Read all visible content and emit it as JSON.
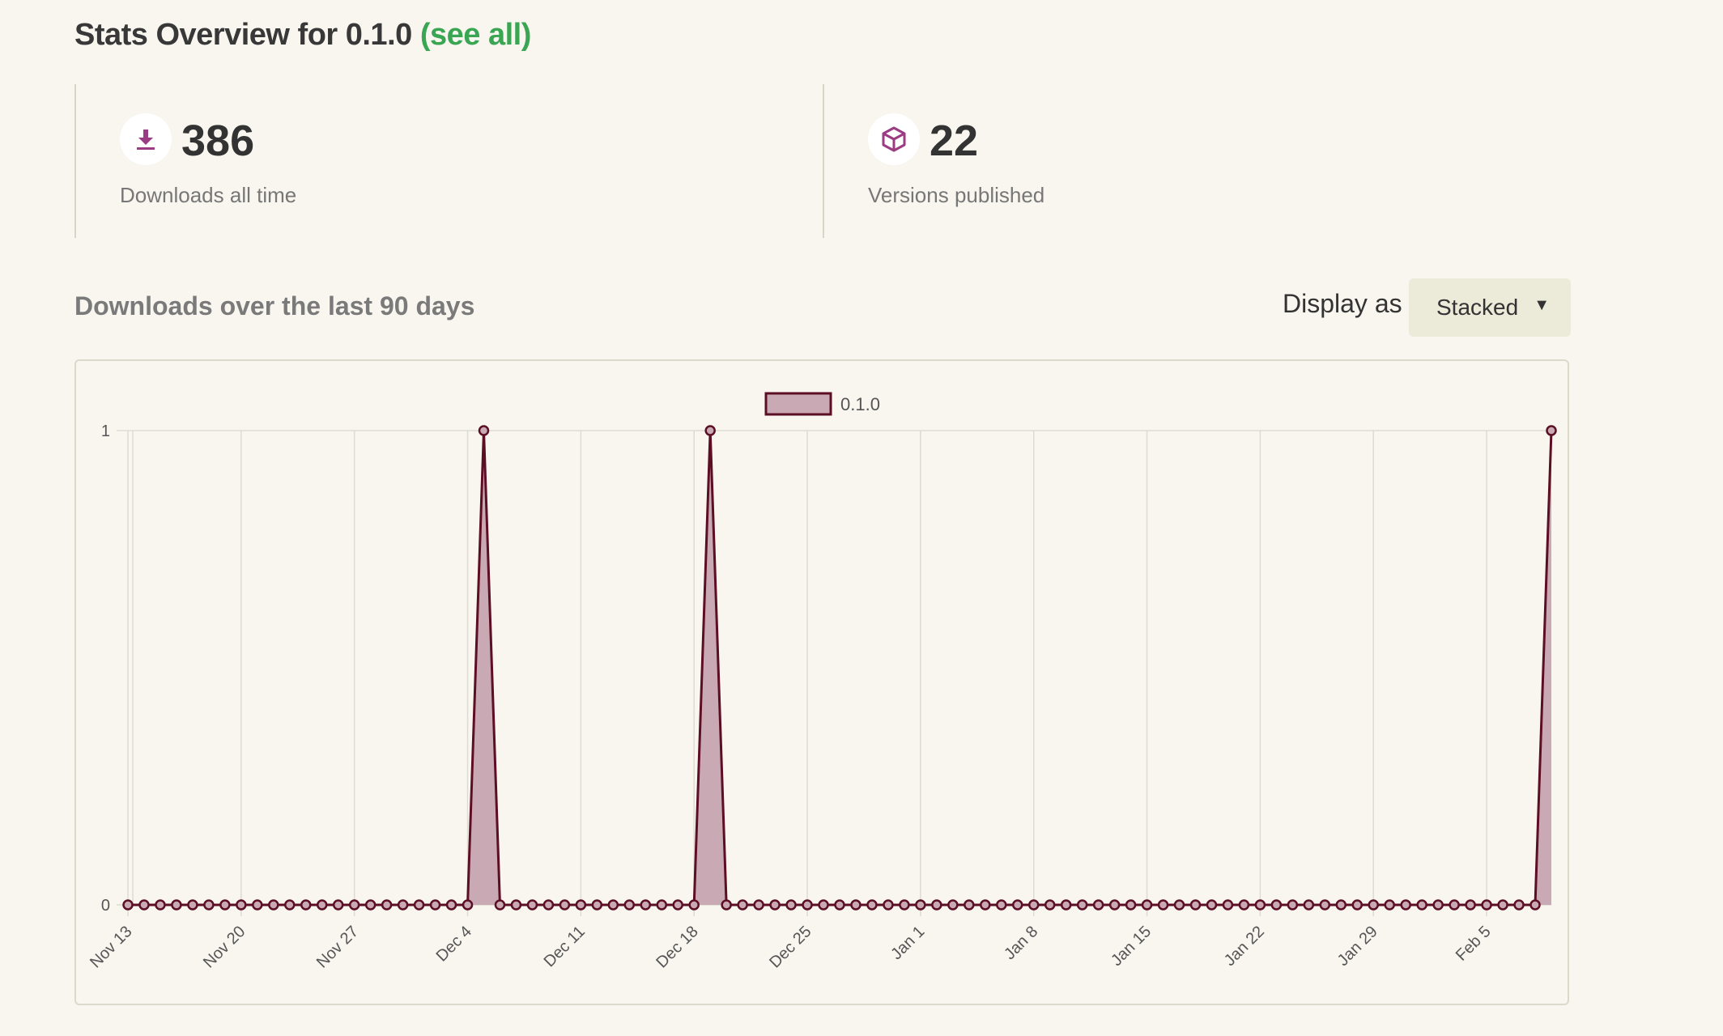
{
  "header": {
    "title_prefix": "Stats Overview for 0.1.0",
    "see_all_label": "(see all)"
  },
  "stats": [
    {
      "icon": "download-icon",
      "value": "386",
      "label": "Downloads all time"
    },
    {
      "icon": "package-icon",
      "value": "22",
      "label": "Versions published"
    }
  ],
  "downloads_section": {
    "title": "Downloads over the last 90 days",
    "display_label": "Display as",
    "display_selected": "Stacked"
  },
  "colors": {
    "accent_green": "#3aa653",
    "icon_purple": "#9b3b82",
    "series_line": "#5c0f24",
    "series_fill": "#c9a9b4"
  },
  "chart_data": {
    "type": "area",
    "title": "",
    "xlabel": "",
    "ylabel": "",
    "ylim": [
      0,
      1
    ],
    "y_ticks": [
      "0",
      "1"
    ],
    "x_tick_labels": [
      "Nov 13",
      "Nov 20",
      "Nov 27",
      "Dec 4",
      "Dec 11",
      "Dec 18",
      "Dec 25",
      "Jan 1",
      "Jan 8",
      "Jan 15",
      "Jan 22",
      "Jan 29",
      "Feb 5"
    ],
    "x_start": "Nov 13",
    "x_end": "Feb 8",
    "grid": true,
    "legend_position": "top-center",
    "series": [
      {
        "name": "0.1.0",
        "values": [
          0,
          0,
          0,
          0,
          0,
          0,
          0,
          0,
          0,
          0,
          0,
          0,
          0,
          0,
          0,
          0,
          0,
          0,
          0,
          0,
          0,
          0,
          1,
          0,
          0,
          0,
          0,
          0,
          0,
          0,
          0,
          0,
          0,
          0,
          0,
          0,
          1,
          0,
          0,
          0,
          0,
          0,
          0,
          0,
          0,
          0,
          0,
          0,
          0,
          0,
          0,
          0,
          0,
          0,
          0,
          0,
          0,
          0,
          0,
          0,
          0,
          0,
          0,
          0,
          0,
          0,
          0,
          0,
          0,
          0,
          0,
          0,
          0,
          0,
          0,
          0,
          0,
          0,
          0,
          0,
          0,
          0,
          0,
          0,
          0,
          0,
          0,
          0,
          1
        ]
      }
    ]
  }
}
